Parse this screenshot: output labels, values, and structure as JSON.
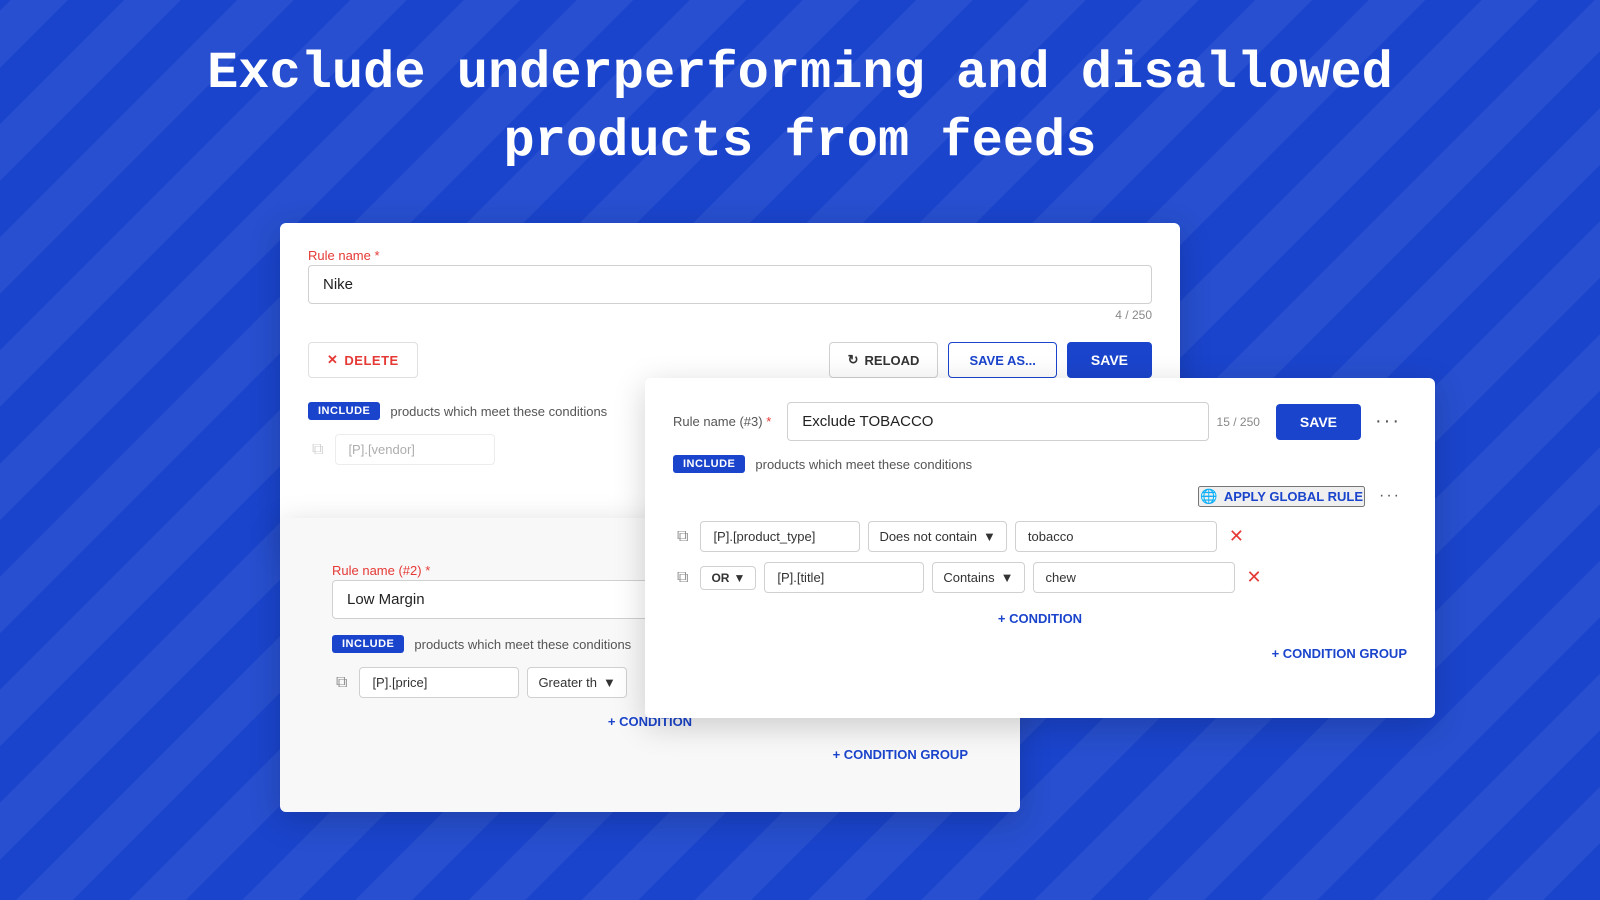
{
  "page": {
    "headline_line1": "Exclude underperforming and disallowed",
    "headline_line2": "products from feeds"
  },
  "panel1": {
    "rule_label": "Rule name",
    "rule_label_required": "*",
    "rule_name_value": "Nike",
    "char_count": "4 / 250",
    "delete_label": "DELETE",
    "reload_label": "RELOAD",
    "save_as_label": "SAVE AS...",
    "save_label": "SAVE",
    "include_badge": "INCLUDE",
    "include_text": "products which meet these conditions",
    "condition_field": "[P].[vendor]"
  },
  "panel2": {
    "rule_label": "Rule name (#2)",
    "rule_label_required": "*",
    "rule_name_value": "Low Margin",
    "include_badge": "INCLUDE",
    "include_text": "products which meet these conditions",
    "condition_field": "[P].[price]",
    "condition_operator": "Greater th",
    "add_condition_label": "+ CONDITION",
    "add_condition_group_label": "+ CONDITION GROUP"
  },
  "panel3": {
    "rule_label": "Rule name (#3)",
    "rule_label_required": "*",
    "rule_name_value": "Exclude TOBACCO",
    "char_count": "15 / 250",
    "save_label": "SAVE",
    "dots_label": "···",
    "include_badge": "INCLUDE",
    "include_text": "products which meet these conditions",
    "apply_global_label": "APPLY GLOBAL RULE",
    "apply_dots": "···",
    "row1": {
      "field": "[P].[product_type]",
      "operator": "Does not contain",
      "value": "tobacco"
    },
    "row2": {
      "logic": "OR",
      "field": "[P].[title]",
      "operator": "Contains",
      "value": "chew"
    },
    "add_condition_label": "+ CONDITION",
    "add_condition_group_label": "+ CONDITION GROUP"
  }
}
